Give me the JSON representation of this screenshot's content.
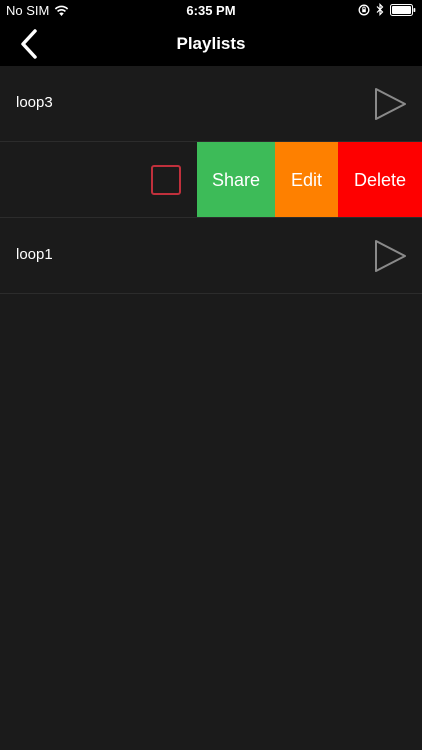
{
  "status_bar": {
    "carrier": "No SIM",
    "time": "6:35 PM"
  },
  "nav": {
    "title": "Playlists"
  },
  "playlists": [
    {
      "name": "loop3"
    },
    {
      "name": ""
    },
    {
      "name": "loop1"
    }
  ],
  "swipe_actions": {
    "share": "Share",
    "edit": "Edit",
    "delete": "Delete"
  },
  "colors": {
    "share": "#3dbb58",
    "edit": "#fe8000",
    "delete": "#fe0000",
    "checkbox_border": "#c0303c",
    "background": "#1b1b1b"
  }
}
